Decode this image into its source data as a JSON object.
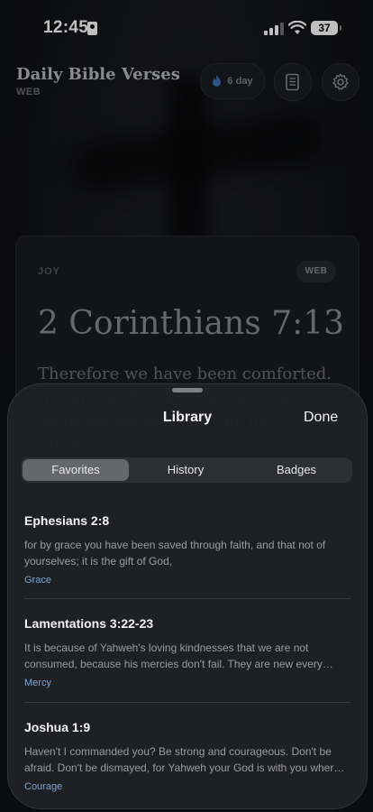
{
  "status_bar": {
    "time": "12:45",
    "battery": "37"
  },
  "header": {
    "title": "Daily Bible Verses",
    "subtitle": "WEB",
    "streak_label": "6  day"
  },
  "verse_card": {
    "topic": "JOY",
    "translation": "WEB",
    "reference": "2 Corinthians 7:13",
    "text": "Therefore we have been comforted. In our comfort we rejoiced the more exceedingly for the joy of Titus."
  },
  "library_sheet": {
    "title": "Library",
    "done_label": "Done",
    "tabs": [
      {
        "label": "Favorites",
        "active": true
      },
      {
        "label": "History",
        "active": false
      },
      {
        "label": "Badges",
        "active": false
      }
    ],
    "favorites": [
      {
        "reference": "Ephesians 2:8",
        "text": "for by grace you have been saved through faith, and that not of yourselves; it is the gift of God,",
        "tag": "Grace"
      },
      {
        "reference": "Lamentations 3:22-23",
        "text": "It is because of Yahweh's loving kindnesses that we are not consumed, because his mercies don't fail. They are new every…",
        "tag": "Mercy"
      },
      {
        "reference": "Joshua 1:9",
        "text": "Haven't I commanded you? Be strong and courageous. Don't be afraid. Don't be dismayed, for Yahweh your God is with you wher…",
        "tag": "Courage"
      }
    ]
  },
  "colors": {
    "accent_tag": "#7aa3cf",
    "sheet_bg": "#202125",
    "segment_active": "#66676c"
  }
}
